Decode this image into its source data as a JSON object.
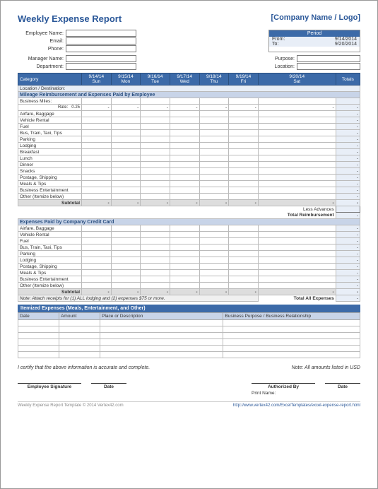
{
  "title": "Weekly Expense Report",
  "logo": "[Company Name / Logo]",
  "emp": {
    "name_lbl": "Employee Name:",
    "email_lbl": "Email:",
    "phone_lbl": "Phone:",
    "mgr_lbl": "Manager Name:",
    "dept_lbl": "Department:"
  },
  "right": {
    "purpose_lbl": "Purpose:",
    "location_lbl": "Location:"
  },
  "period": {
    "hdr": "Period",
    "from_lbl": "From:",
    "from": "9/14/2014",
    "to_lbl": "To:",
    "to": "9/20/2014"
  },
  "cols": {
    "cat": "Category",
    "totals": "Totals"
  },
  "days": [
    {
      "d": "9/14/14",
      "w": "Sun"
    },
    {
      "d": "9/15/14",
      "w": "Mon"
    },
    {
      "d": "9/16/14",
      "w": "Tue"
    },
    {
      "d": "9/17/14",
      "w": "Wed"
    },
    {
      "d": "9/18/14",
      "w": "Thu"
    },
    {
      "d": "9/19/14",
      "w": "Fri"
    },
    {
      "d": "9/20/14",
      "w": "Sat"
    }
  ],
  "loc_dest": "Location / Destination:",
  "sec1": {
    "title": "Mileage Reimbursement and Expenses Paid by Employee",
    "miles": "Business Miles:",
    "rate_lbl": "Rate:",
    "rate": "0.25",
    "rows": [
      "Airfare, Baggage",
      "Vehicle Rental",
      "Fuel",
      "Bus, Train, Taxi, Tips",
      "Parking",
      "Lodging",
      "Breakfast",
      "Lunch",
      "Dinner",
      "Snacks",
      "Postage, Shipping",
      "Meals & Tips",
      "Business Entertainment",
      "Other (Itemize below)"
    ],
    "subtotal": "Subtotal",
    "less": "Less Advances",
    "total": "Total Reimbursement"
  },
  "sec2": {
    "title": "Expenses Paid by Company Credit Card",
    "rows": [
      "Airfare, Baggage",
      "Vehicle Rental",
      "Fuel",
      "Bus, Train, Taxi, Tips",
      "Parking",
      "Lodging",
      "Postage, Shipping",
      "Meals & Tips",
      "Business Entertainment",
      "Other (Itemize below)"
    ],
    "subtotal": "Subtotal",
    "note": "Note: Attach receipts for (1) ALL lodging and (2) expenses $75 or more.",
    "total": "Total All Expenses"
  },
  "sec3": {
    "title": "Itemized Expenses (Meals, Entertainment, and Other)",
    "cols": [
      "Date",
      "Amount",
      "Place or Description",
      "Business Purpose / Business Relationship"
    ],
    "rows": 6
  },
  "cert": "I certify that the above information is accurate and complete.",
  "cert_note": "Note: All amounts listed in USD",
  "sig": {
    "emp": "Employee Signature",
    "date": "Date",
    "auth": "Authorized By",
    "print": "Print Name:"
  },
  "footer": {
    "l": "Weekly Expense Report Template © 2014 Vertex42.com",
    "r": "http://www.vertex42.com/ExcelTemplates/excel-expense-report.html"
  },
  "dash": "-"
}
